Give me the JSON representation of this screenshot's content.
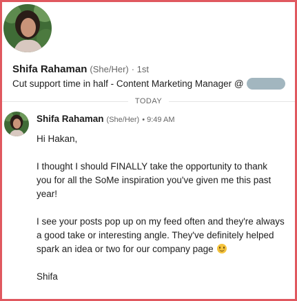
{
  "profile": {
    "name": "Shifa Rahaman",
    "pronouns": "(She/Her)",
    "degree": "· 1st",
    "headline": "Cut support time in half - Content Marketing Manager @"
  },
  "divider": {
    "label": "TODAY"
  },
  "message": {
    "sender": "Shifa Rahaman",
    "pronouns": "(She/Her)",
    "time": "• 9:49 AM",
    "paragraphs": [
      "Hi Hakan,",
      "I thought I should FINALLY take the opportunity to thank you for all the SoMe inspiration you've given me this past year!",
      "I see your posts pop up on my feed often and they're always a good take or interesting angle. They've definitely helped spark an idea or two for our company page",
      "Shifa"
    ],
    "emoji": "smiling-face-icon"
  },
  "colors": {
    "border": "#e0585f",
    "muted": "#666666",
    "redaction": "#a2b6bf"
  }
}
